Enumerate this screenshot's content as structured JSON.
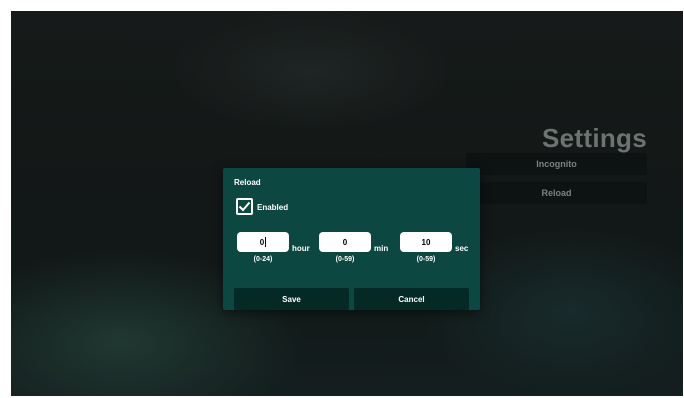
{
  "settings": {
    "title": "Settings",
    "menu": [
      {
        "label": "Incognito"
      },
      {
        "label": "Reload"
      }
    ]
  },
  "dialog": {
    "title": "Reload",
    "enabled_label": "Enabled",
    "enabled": true,
    "hour": {
      "value": "0",
      "unit": "hour",
      "range": "(0-24)"
    },
    "min": {
      "value": "0",
      "unit": "min",
      "range": "(0-59)"
    },
    "sec": {
      "value": "10",
      "unit": "sec",
      "range": "(0-59)"
    },
    "save_label": "Save",
    "cancel_label": "Cancel"
  },
  "colors": {
    "dialog_bg": "#0c4741",
    "button_bg": "#052a26",
    "menu_bg": "#0a0e0e"
  },
  "icons": {
    "checkbox": "checkmark-icon"
  }
}
